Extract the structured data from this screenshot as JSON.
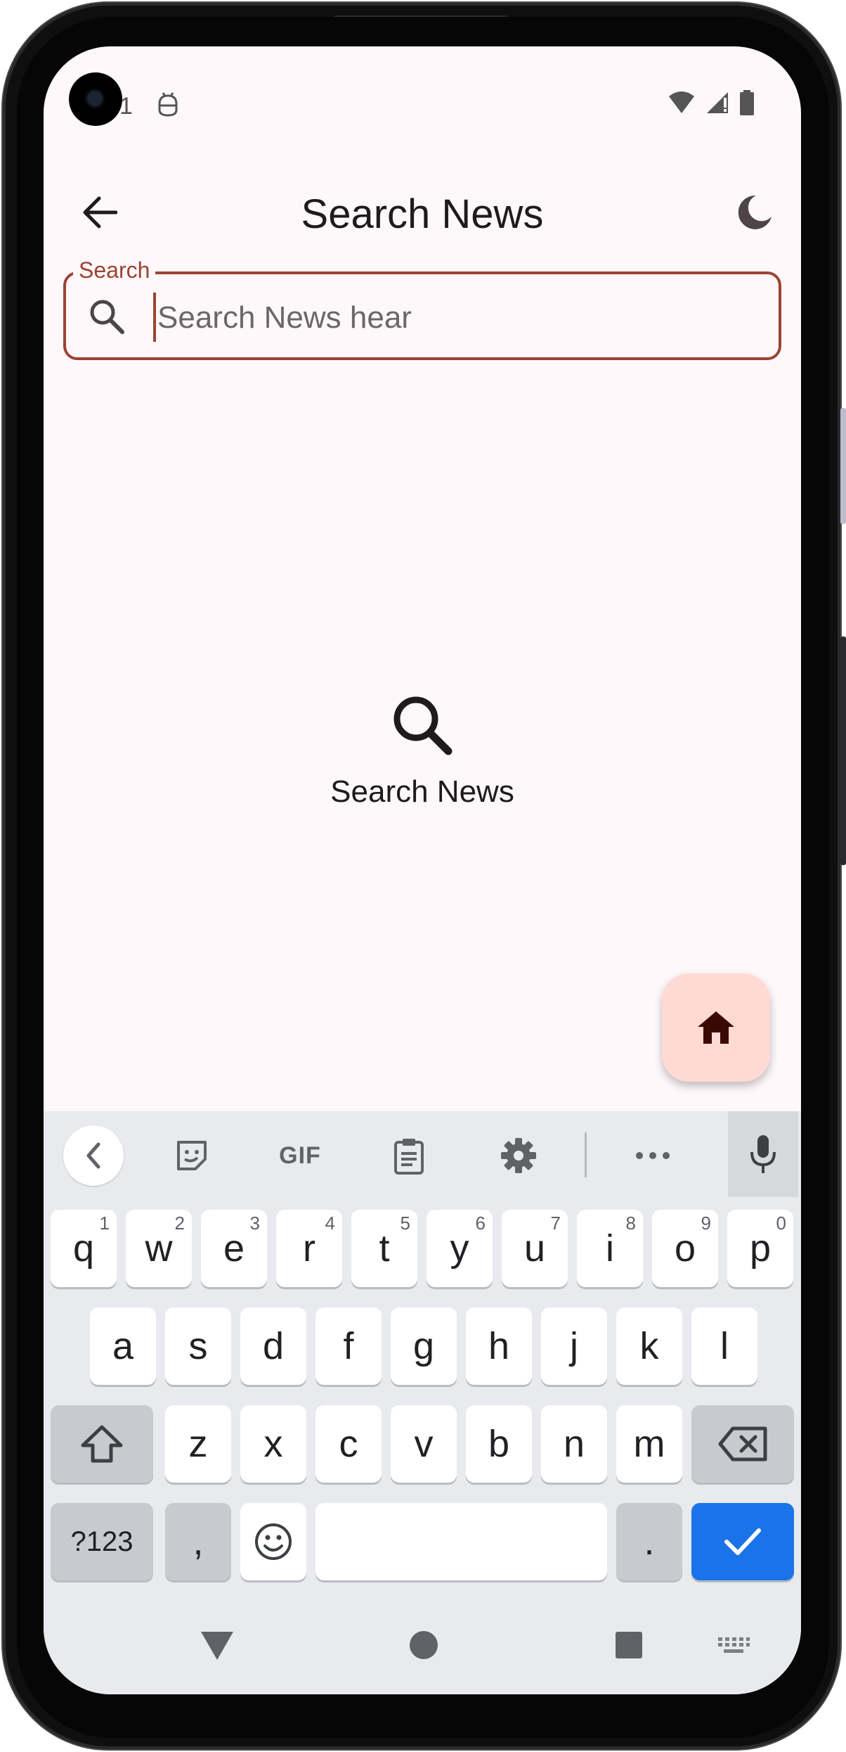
{
  "status_bar": {
    "left_text": "1",
    "icons": [
      "android-debug-icon",
      "wifi-icon",
      "signal-icon",
      "battery-icon"
    ]
  },
  "app_bar": {
    "title": "Search News",
    "back_icon": "arrow-back-icon",
    "theme_icon": "dark-mode-icon"
  },
  "search": {
    "label": "Search",
    "placeholder": "Search News hear",
    "value": ""
  },
  "empty_state": {
    "icon": "search-icon",
    "label": "Search News"
  },
  "fab": {
    "icon": "home-icon"
  },
  "keyboard": {
    "toolbar": {
      "gif_label": "GIF",
      "tools": [
        "chevron-left-icon",
        "sticker-icon",
        "gif",
        "clipboard-icon",
        "settings-icon",
        "more-icon",
        "mic-icon"
      ]
    },
    "row1": [
      {
        "key": "q",
        "hint": "1"
      },
      {
        "key": "w",
        "hint": "2"
      },
      {
        "key": "e",
        "hint": "3"
      },
      {
        "key": "r",
        "hint": "4"
      },
      {
        "key": "t",
        "hint": "5"
      },
      {
        "key": "y",
        "hint": "6"
      },
      {
        "key": "u",
        "hint": "7"
      },
      {
        "key": "i",
        "hint": "8"
      },
      {
        "key": "o",
        "hint": "9"
      },
      {
        "key": "p",
        "hint": "0"
      }
    ],
    "row2": [
      "a",
      "s",
      "d",
      "f",
      "g",
      "h",
      "j",
      "k",
      "l"
    ],
    "row3": [
      "z",
      "x",
      "c",
      "v",
      "b",
      "n",
      "m"
    ],
    "row4": {
      "symbols": "?123",
      "comma": ",",
      "period": "."
    }
  },
  "colors": {
    "accent": "#9c4335",
    "background": "#fff8fa",
    "fab": "#ffdad4",
    "fab_icon": "#3b0904",
    "keyboard_bg": "#e8eaed",
    "done_key": "#1a73e8"
  }
}
